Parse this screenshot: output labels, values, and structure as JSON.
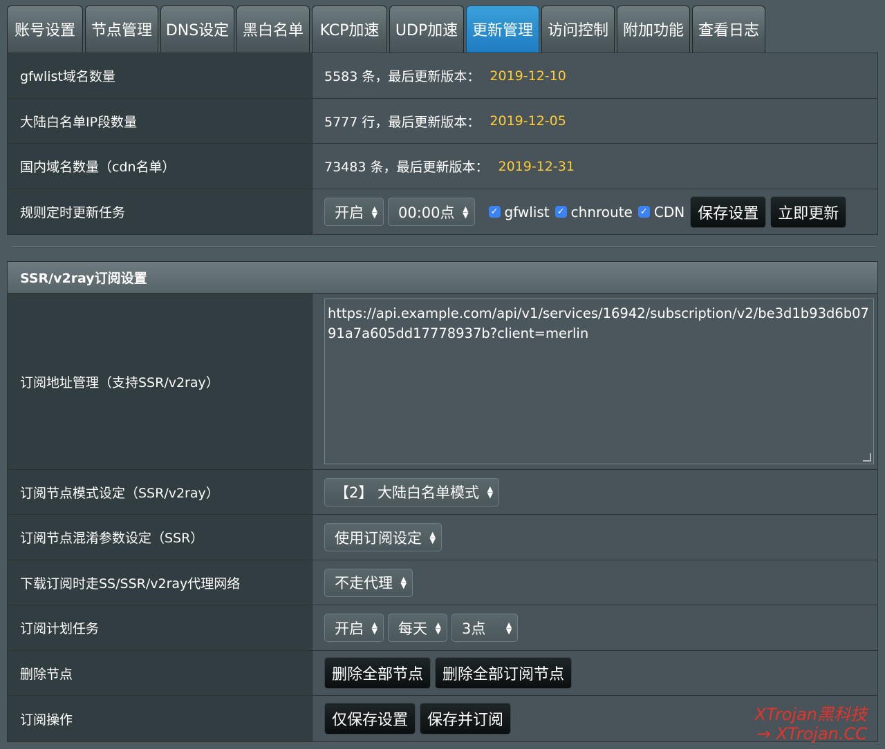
{
  "tabs": [
    "账号设置",
    "节点管理",
    "DNS设定",
    "黑白名单",
    "KCP加速",
    "UDP加速",
    "更新管理",
    "访问控制",
    "附加功能",
    "查看日志"
  ],
  "active_tab": "更新管理",
  "rules": {
    "gfwlist": {
      "label": "gfwlist域名数量",
      "count": "5583 条，最后更新版本：",
      "version": "2019-12-10"
    },
    "chnroute": {
      "label": "大陆白名单IP段数量",
      "count": "5777 行，最后更新版本：",
      "version": "2019-12-05"
    },
    "cdn": {
      "label": "国内域名数量（cdn名单）",
      "count": "73483 条，最后更新版本：",
      "version": "2019-12-31"
    },
    "schedule": {
      "label": "规则定时更新任务",
      "enable_value": "开启",
      "time_value": "00:00点",
      "checks": [
        "gfwlist",
        "chnroute",
        "CDN"
      ],
      "save_button": "保存设置",
      "update_button": "立即更新"
    }
  },
  "subscribe": {
    "section_title": "SSR/v2ray订阅设置",
    "address": {
      "label": "订阅地址管理（支持SSR/v2ray）",
      "value": "https://api.example.com/api/v1/services/16942/subscription/v2/be3d1b93d6b0791a7a605dd17778937b?client=merlin"
    },
    "mode": {
      "label": "订阅节点模式设定（SSR/v2ray）",
      "value": "【2】 大陆白名单模式"
    },
    "obfs": {
      "label": "订阅节点混淆参数设定（SSR）",
      "value": "使用订阅设定"
    },
    "proxy": {
      "label": "下载订阅时走SS/SSR/v2ray代理网络",
      "value": "不走代理"
    },
    "plan": {
      "label": "订阅计划任务",
      "enable": "开启",
      "day": "每天",
      "hour": "3点"
    },
    "delete": {
      "label": "删除节点",
      "all": "删除全部节点",
      "sub": "删除全部订阅节点"
    },
    "ops": {
      "label": "订阅操作",
      "save_only": "仅保存设置",
      "save_sub": "保存并订阅"
    }
  },
  "watermark": {
    "line1": "XTrojan黑科技",
    "line2": "→ XTrojan.CC"
  },
  "colors": {
    "accent": "#2a8fd4",
    "version": "#ffcc33",
    "checkbox": "#3a82f6"
  }
}
